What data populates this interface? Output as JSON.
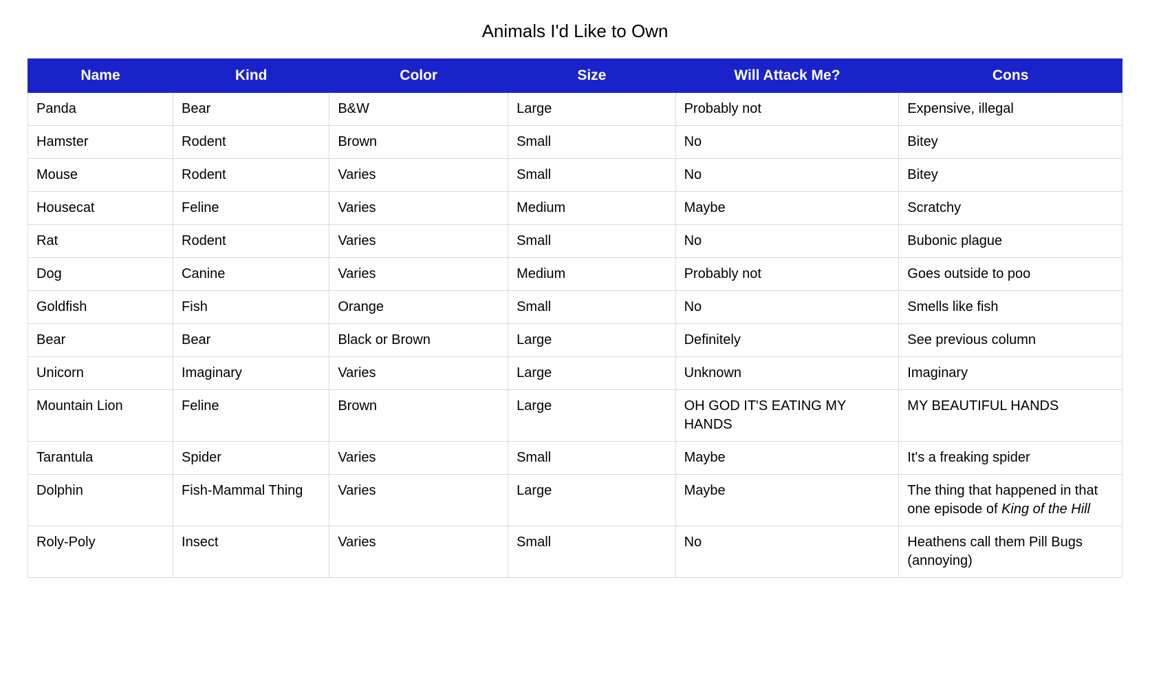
{
  "title": "Animals I'd Like to Own",
  "columns": [
    "Name",
    "Kind",
    "Color",
    "Size",
    "Will Attack Me?",
    "Cons"
  ],
  "rows": [
    {
      "name": "Panda",
      "kind": "Bear",
      "color": "B&W",
      "size": "Large",
      "attack": "Probably not",
      "cons": "Expensive, illegal"
    },
    {
      "name": "Hamster",
      "kind": "Rodent",
      "color": "Brown",
      "size": "Small",
      "attack": "No",
      "cons": "Bitey"
    },
    {
      "name": "Mouse",
      "kind": "Rodent",
      "color": "Varies",
      "size": "Small",
      "attack": "No",
      "cons": "Bitey"
    },
    {
      "name": "Housecat",
      "kind": "Feline",
      "color": "Varies",
      "size": "Medium",
      "attack": "Maybe",
      "cons": "Scratchy"
    },
    {
      "name": "Rat",
      "kind": "Rodent",
      "color": "Varies",
      "size": "Small",
      "attack": "No",
      "cons": "Bubonic plague"
    },
    {
      "name": "Dog",
      "kind": "Canine",
      "color": "Varies",
      "size": "Medium",
      "attack": "Probably not",
      "cons": "Goes outside to poo"
    },
    {
      "name": "Goldfish",
      "kind": "Fish",
      "color": "Orange",
      "size": "Small",
      "attack": "No",
      "cons": "Smells like fish"
    },
    {
      "name": "Bear",
      "kind": "Bear",
      "color": "Black or Brown",
      "size": "Large",
      "attack": "Definitely",
      "cons": "See previous column"
    },
    {
      "name": "Unicorn",
      "kind": "Imaginary",
      "color": "Varies",
      "size": "Large",
      "attack": "Unknown",
      "cons": "Imaginary"
    },
    {
      "name": "Mountain Lion",
      "kind": "Feline",
      "color": "Brown",
      "size": "Large",
      "attack": "OH GOD IT'S EATING MY HANDS",
      "cons": "MY BEAUTIFUL HANDS"
    },
    {
      "name": "Tarantula",
      "kind": "Spider",
      "color": "Varies",
      "size": "Small",
      "attack": "Maybe",
      "cons": "It's a freaking spider"
    },
    {
      "name": "Dolphin",
      "kind": "Fish-Mammal Thing",
      "color": "Varies",
      "size": "Large",
      "attack": "Maybe",
      "cons_prefix": "The thing that happened in that one episode of ",
      "cons_italic": "King of the Hill"
    },
    {
      "name": "Roly-Poly",
      "kind": "Insect",
      "color": "Varies",
      "size": "Small",
      "attack": "No",
      "cons": "Heathens call them Pill Bugs (annoying)"
    }
  ]
}
